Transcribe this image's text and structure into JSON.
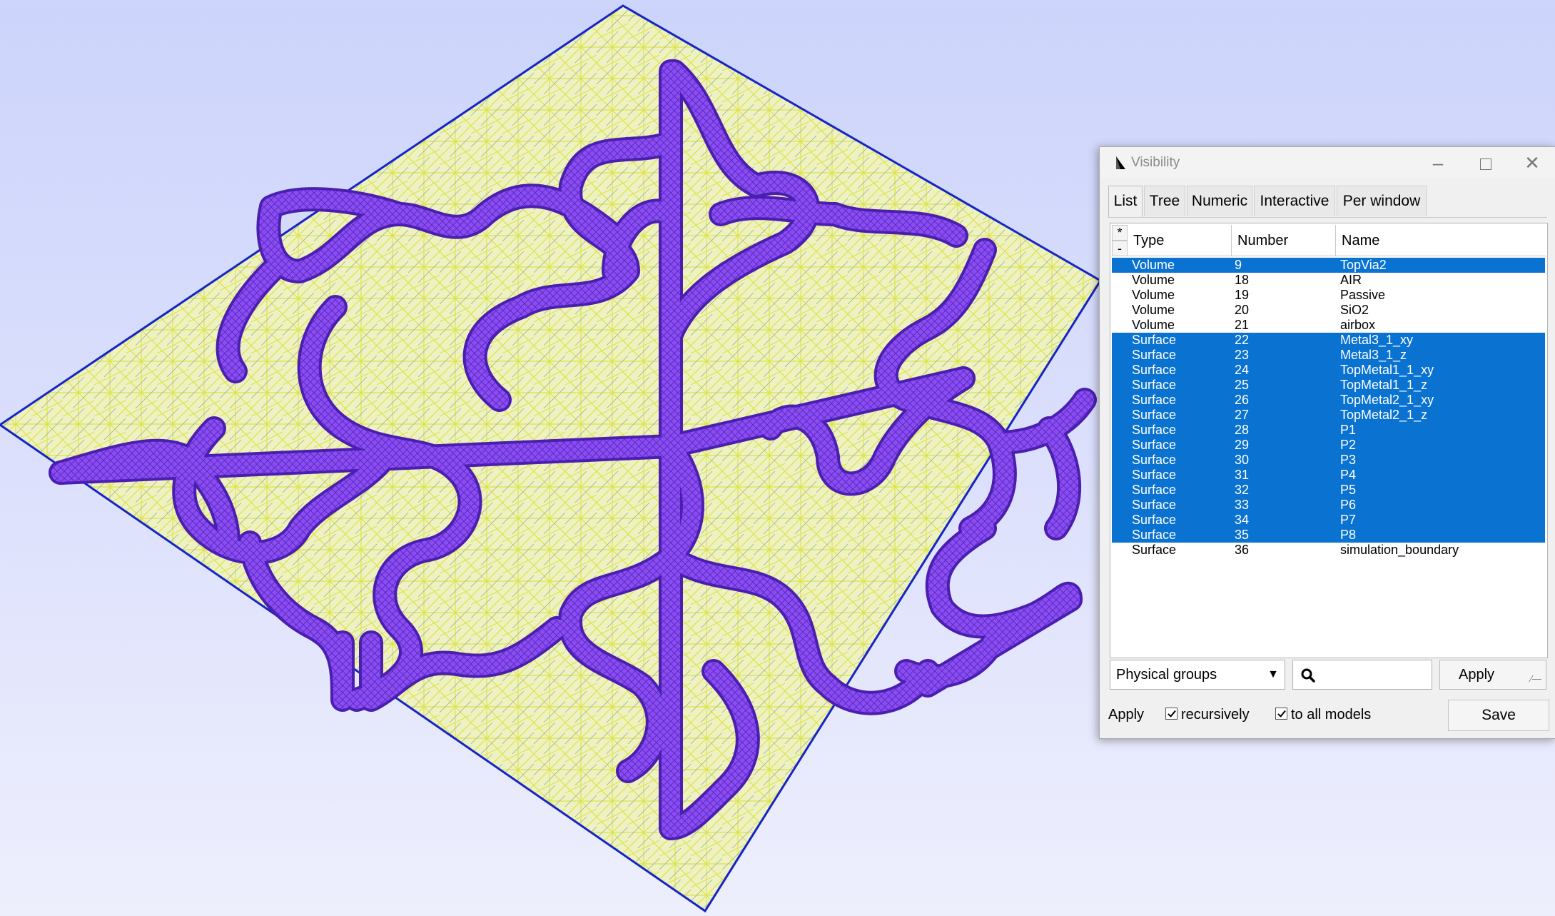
{
  "dialog": {
    "title": "Visibility",
    "tabs": [
      "List",
      "Tree",
      "Numeric",
      "Interactive",
      "Per window"
    ],
    "active_tab": "List",
    "list": {
      "select_all": "*",
      "select_none": "-",
      "columns": [
        "Type",
        "Number",
        "Name"
      ],
      "rows": [
        {
          "type": "Volume",
          "number": "9",
          "name": "TopVia2",
          "selected": true
        },
        {
          "type": "Volume",
          "number": "18",
          "name": "AIR",
          "selected": false
        },
        {
          "type": "Volume",
          "number": "19",
          "name": "Passive",
          "selected": false
        },
        {
          "type": "Volume",
          "number": "20",
          "name": "SiO2",
          "selected": false
        },
        {
          "type": "Volume",
          "number": "21",
          "name": "airbox",
          "selected": false
        },
        {
          "type": "Surface",
          "number": "22",
          "name": "Metal3_1_xy",
          "selected": true
        },
        {
          "type": "Surface",
          "number": "23",
          "name": "Metal3_1_z",
          "selected": true
        },
        {
          "type": "Surface",
          "number": "24",
          "name": "TopMetal1_1_xy",
          "selected": true
        },
        {
          "type": "Surface",
          "number": "25",
          "name": "TopMetal1_1_z",
          "selected": true
        },
        {
          "type": "Surface",
          "number": "26",
          "name": "TopMetal2_1_xy",
          "selected": true
        },
        {
          "type": "Surface",
          "number": "27",
          "name": "TopMetal2_1_z",
          "selected": true
        },
        {
          "type": "Surface",
          "number": "28",
          "name": "P1",
          "selected": true
        },
        {
          "type": "Surface",
          "number": "29",
          "name": "P2",
          "selected": true
        },
        {
          "type": "Surface",
          "number": "30",
          "name": "P3",
          "selected": true
        },
        {
          "type": "Surface",
          "number": "31",
          "name": "P4",
          "selected": true
        },
        {
          "type": "Surface",
          "number": "32",
          "name": "P5",
          "selected": true
        },
        {
          "type": "Surface",
          "number": "33",
          "name": "P6",
          "selected": true
        },
        {
          "type": "Surface",
          "number": "34",
          "name": "P7",
          "selected": true
        },
        {
          "type": "Surface",
          "number": "35",
          "name": "P8",
          "selected": true
        },
        {
          "type": "Surface",
          "number": "36",
          "name": "simulation_boundary",
          "selected": false
        }
      ]
    },
    "filter": {
      "mode": "Physical groups",
      "search_value": "",
      "apply_label": "Apply"
    },
    "footer": {
      "apply_label": "Apply",
      "recursively_label": "recursively",
      "recursively_checked": true,
      "all_models_label": "to all models",
      "all_models_checked": true,
      "save_label": "Save"
    }
  },
  "colors": {
    "selection": "#0a72d1",
    "mesh_fill": "#eef0b0",
    "mesh_lines": "#e8ee2a",
    "trace": "#7a3fe0",
    "substrate_edge": "#1424c8"
  },
  "icons": [
    "gmsh-logo-icon",
    "minimize-icon",
    "maximize-icon",
    "close-icon",
    "dropdown-arrow-icon",
    "search-icon",
    "resize-grip-icon"
  ]
}
